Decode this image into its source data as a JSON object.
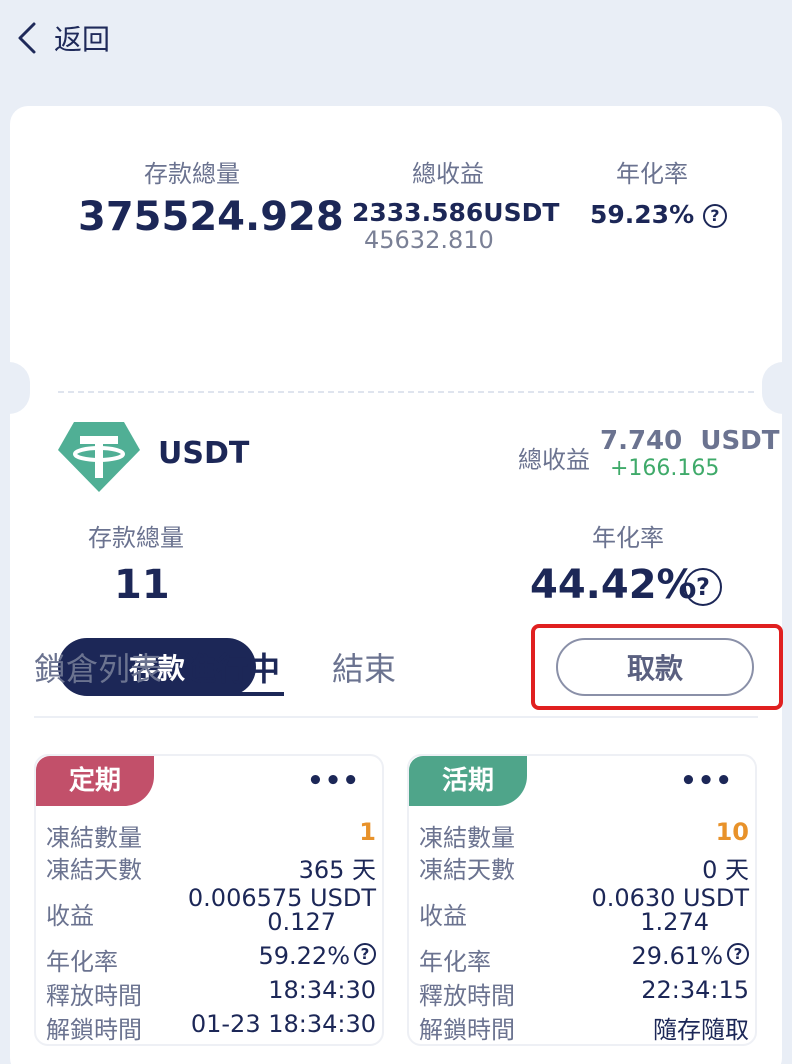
{
  "header": {
    "back_label": "返回"
  },
  "summary": {
    "deposit_label": "存款總量",
    "deposit_value": "375524.928",
    "earnings_label": "總收益",
    "earnings_value": "2333.586USDT",
    "earnings_sub": "45632.810",
    "apy_label": "年化率",
    "apy_value": "59.23%"
  },
  "coin": {
    "name": "USDT",
    "earn_label": "總收益",
    "earn_value": "7.740  USDT",
    "earn_delta": "+166.165",
    "deposit_label": "存款總量",
    "deposit_value": "11",
    "apy_label": "年化率",
    "apy_value": "44.42%",
    "deposit_button": "存款",
    "withdraw_button": "取款",
    "logo_color": "#50af95"
  },
  "tabs": [
    {
      "label": "鎖倉列表",
      "active": false
    },
    {
      "label": "進行中",
      "active": true
    },
    {
      "label": "結束",
      "active": false
    }
  ],
  "locks": [
    {
      "type": "定期",
      "badge_color": "#c2506a",
      "more": "•••",
      "rows": {
        "qty_label": "凍結數量",
        "qty_value": "1",
        "days_label": "凍結天數",
        "days_value": "365 天",
        "income_label": "收益",
        "income_value": "0.006575 USDT",
        "income_sub": "0.127",
        "apy_label": "年化率",
        "apy_value": "59.22%",
        "release_label": "釋放時間",
        "release_value": "18:34:30",
        "unlock_label": "解鎖時間",
        "unlock_value": "01-23 18:34:30"
      }
    },
    {
      "type": "活期",
      "badge_color": "#4fa58a",
      "more": "•••",
      "rows": {
        "qty_label": "凍結數量",
        "qty_value": "10",
        "days_label": "凍結天數",
        "days_value": "0 天",
        "income_label": "收益",
        "income_value": "0.0630 USDT",
        "income_sub": "1.274",
        "apy_label": "年化率",
        "apy_value": "29.61%",
        "release_label": "釋放時間",
        "release_value": "22:34:15",
        "unlock_label": "解鎖時間",
        "unlock_value": "隨存隨取"
      }
    }
  ]
}
